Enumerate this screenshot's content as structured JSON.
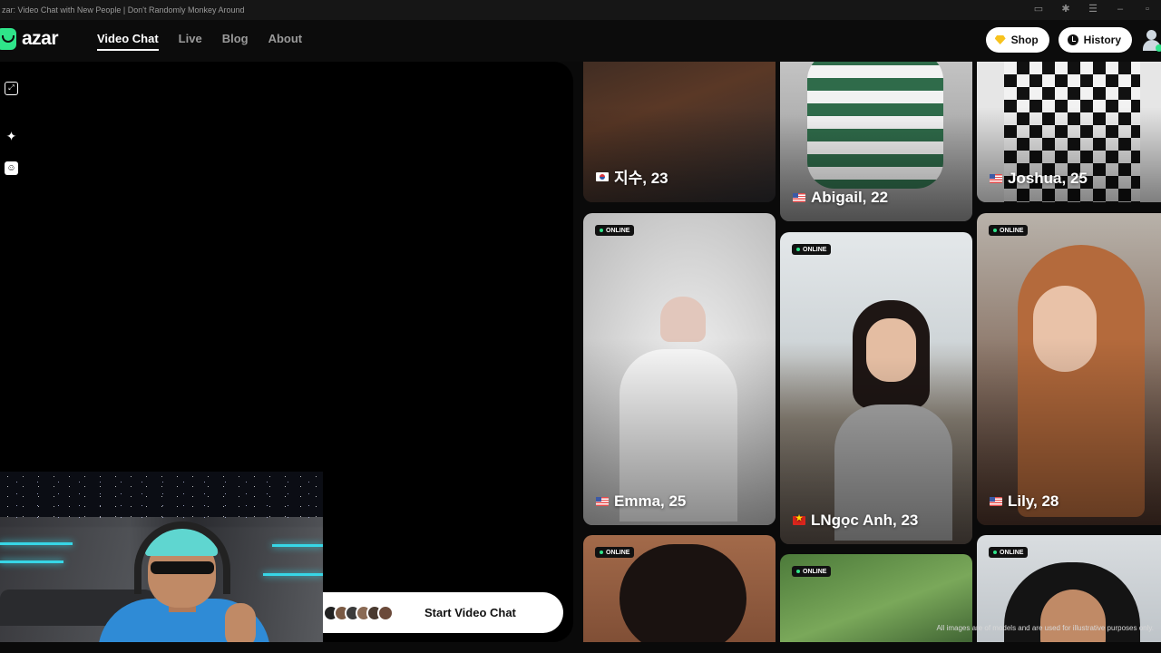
{
  "window": {
    "title": "zar: Video Chat with New People | Don't Randomly Monkey Around",
    "controls": [
      "camera-icon",
      "extension-icon",
      "menu-icon",
      "minimize-icon",
      "restore-icon"
    ]
  },
  "nav": {
    "logo": "azar",
    "links": [
      {
        "label": "Video Chat",
        "active": true
      },
      {
        "label": "Live",
        "active": false
      },
      {
        "label": "Blog",
        "active": false
      },
      {
        "label": "About",
        "active": false
      }
    ],
    "shop_label": "Shop",
    "history_label": "History"
  },
  "video_panel": {
    "side_icons": [
      "expand-icon",
      "sparkle-icon",
      "face-filter-icon"
    ],
    "start_button_label": "Start Video Chat"
  },
  "colors": {
    "accent": "#2fe48a",
    "shop_icon": "#f7c21d",
    "page_bg": "#0a0a0a"
  },
  "gallery": {
    "cards": [
      {
        "name": "지수, 23",
        "flag": "kr",
        "online": false,
        "badge": ""
      },
      {
        "name": "Abigail, 22",
        "flag": "us",
        "online": false,
        "badge": ""
      },
      {
        "name": "Joshua, 25",
        "flag": "us",
        "online": false,
        "badge": ""
      },
      {
        "name": "Emma, 25",
        "flag": "us",
        "online": true,
        "badge": "ONLINE"
      },
      {
        "name": "LNgọc Anh, 23",
        "flag": "vn",
        "online": true,
        "badge": "ONLINE"
      },
      {
        "name": "Lily, 28",
        "flag": "us",
        "online": true,
        "badge": "ONLINE"
      },
      {
        "name": "",
        "flag": "",
        "online": true,
        "badge": "ONLINE"
      },
      {
        "name": "",
        "flag": "",
        "online": true,
        "badge": "ONLINE"
      },
      {
        "name": "",
        "flag": "",
        "online": true,
        "badge": "ONLINE"
      }
    ],
    "disclaimer": "All images are of models and are used for illustrative purposes only."
  }
}
